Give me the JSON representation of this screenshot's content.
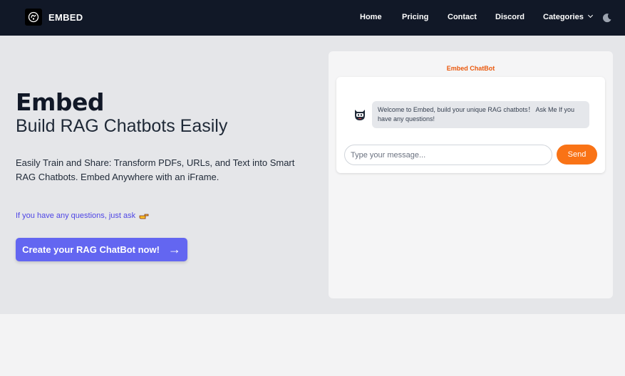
{
  "navbar": {
    "brand": "EMBED",
    "links": [
      "Home",
      "Pricing",
      "Contact",
      "Discord",
      "Categories"
    ],
    "categories_caret": "˅"
  },
  "hero": {
    "title": "Embed",
    "subtitle": "Build RAG Chatbots Easily",
    "description": "Easily Train and Share: Transform PDFs, URLs, and Text into Smart RAG Chatbots. Embed Anywhere with an iFrame.",
    "questions_text": "If you have any questions, just ask",
    "questions_icon": "pointing-hand-icon",
    "cta_label": "Create your RAG ChatBot now!",
    "cta_arrow": "→"
  },
  "chat": {
    "title": "Embed ChatBot",
    "bot_message": "Welcome to Embed, build your unique RAG chatbots！ Ask Me If you have any questions!",
    "input_placeholder": "Type your message...",
    "send_label": "Send"
  },
  "colors": {
    "navbar_bg": "#111827",
    "hero_bg": "#e5e6e9",
    "cta_bg": "#6366f1",
    "send_bg": "#f97316",
    "chat_title": "#ea580c",
    "question_link": "#4f46e5"
  }
}
